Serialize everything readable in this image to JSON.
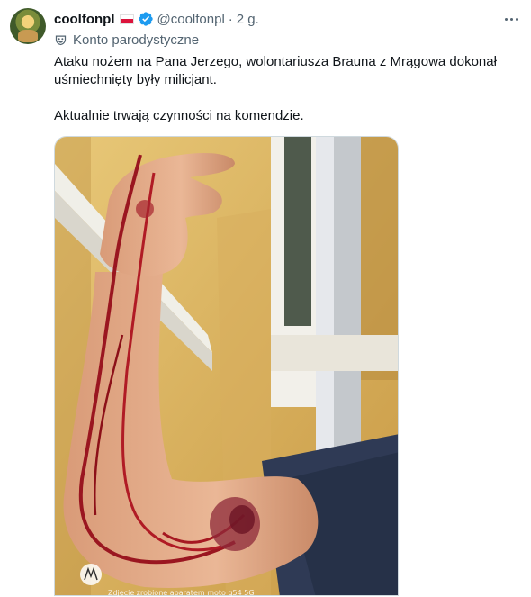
{
  "author": {
    "display_name": "coolfonpl",
    "handle": "@coolfonpl",
    "time": "2 g.",
    "flag": "poland-flag-icon",
    "verified": "verified-badge-icon",
    "parody_label": "Konto parodystyczne",
    "avatar": "user-avatar"
  },
  "tweet": {
    "paragraph1": "Ataku nożem na Pana Jerzego, wolontariusza Brauna z Mrągowa dokonał uśmiechnięty były milicjant.",
    "paragraph2": "Aktualnie trwają czynności na komendzie."
  },
  "media": {
    "watermark": "Zdjęcie zrobione aparatem moto g54 5G"
  },
  "colors": {
    "accent": "#1d9bf0",
    "text": "#0f1419",
    "muted": "#536471",
    "flag_red": "#dc143c"
  }
}
